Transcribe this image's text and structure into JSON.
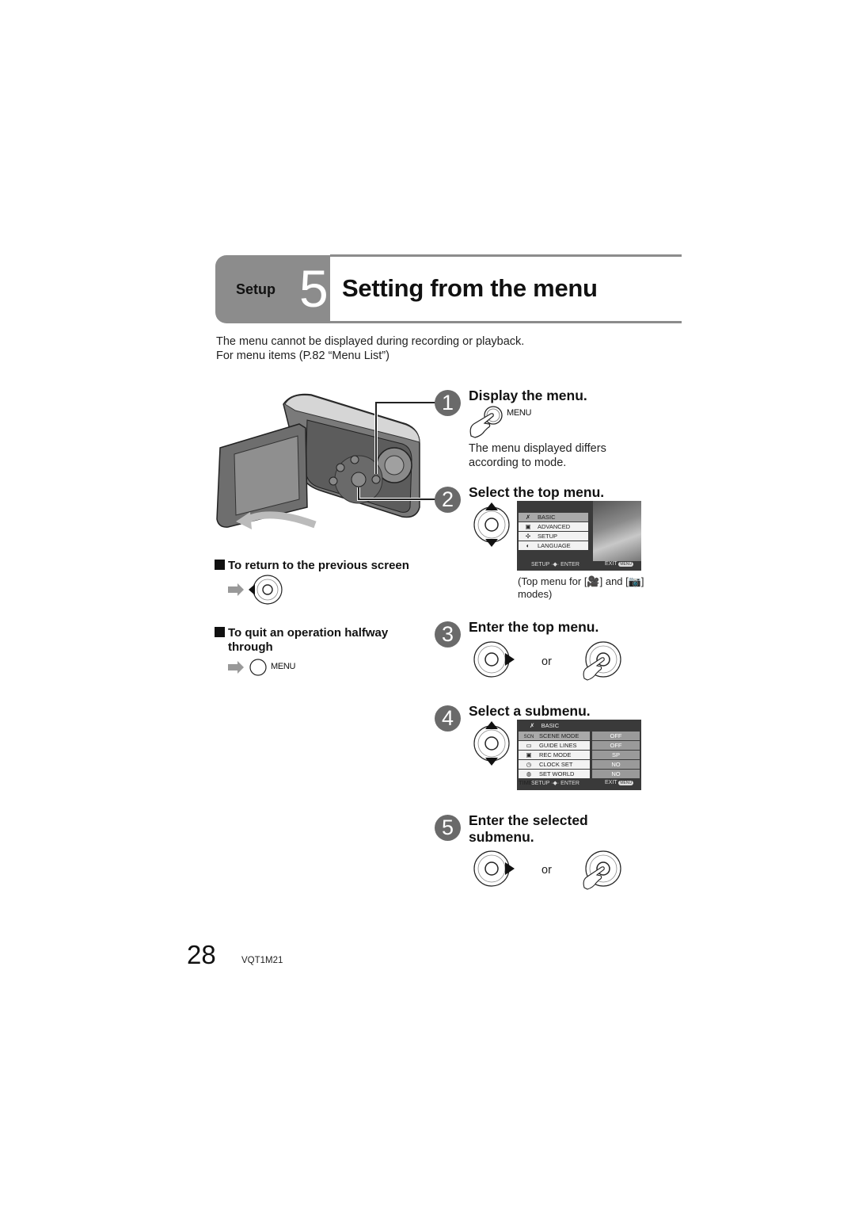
{
  "header": {
    "section_label": "Setup",
    "section_number": "5",
    "title": "Setting from the menu"
  },
  "intro": {
    "line1": "The menu cannot be displayed during recording or playback.",
    "line2": "For menu items (P.82 “Menu List”)"
  },
  "steps": [
    {
      "number": "1",
      "title": "Display the menu.",
      "button_label": "MENU",
      "note_line1": "The menu displayed differs",
      "note_line2": "according to mode."
    },
    {
      "number": "2",
      "title": "Select the top menu.",
      "screen": {
        "items": [
          "BASIC",
          "ADVANCED",
          "SETUP",
          "LANGUAGE"
        ],
        "selected": "BASIC",
        "footer_left": "SETUP ·◆· ENTER",
        "footer_right": "EXIT",
        "footer_badge": "MENU"
      },
      "caption_line1": "(Top menu for [🎥] and [📷]",
      "caption_line2": "modes)"
    },
    {
      "number": "3",
      "title": "Enter the top menu.",
      "or_label": "or"
    },
    {
      "number": "4",
      "title": "Select a submenu.",
      "screen": {
        "header": "BASIC",
        "rows": [
          {
            "icon": "SCN",
            "label": "SCENE MODE",
            "value": "OFF"
          },
          {
            "icon": "▭",
            "label": "GUIDE LINES",
            "value": "OFF"
          },
          {
            "icon": "▣",
            "label": "REC MODE",
            "value": "SP"
          },
          {
            "icon": "◷",
            "label": "CLOCK SET",
            "value": "NO"
          },
          {
            "icon": "◍",
            "label": "SET WORLD TIME",
            "value": "NO"
          }
        ],
        "selected": "SCENE MODE",
        "footer_left": "SETUP ·◆· ENTER",
        "footer_right": "EXIT",
        "footer_badge": "MENU"
      }
    },
    {
      "number": "5",
      "title_line1": "Enter the selected",
      "title_line2": "submenu.",
      "or_label": "or"
    }
  ],
  "tips": {
    "return_heading": "To return to the previous screen",
    "quit_heading_line1": "To quit an operation halfway",
    "quit_heading_line2": "through",
    "quit_button_label": "MENU"
  },
  "footer": {
    "page_number": "28",
    "model_code": "VQT1M21"
  }
}
